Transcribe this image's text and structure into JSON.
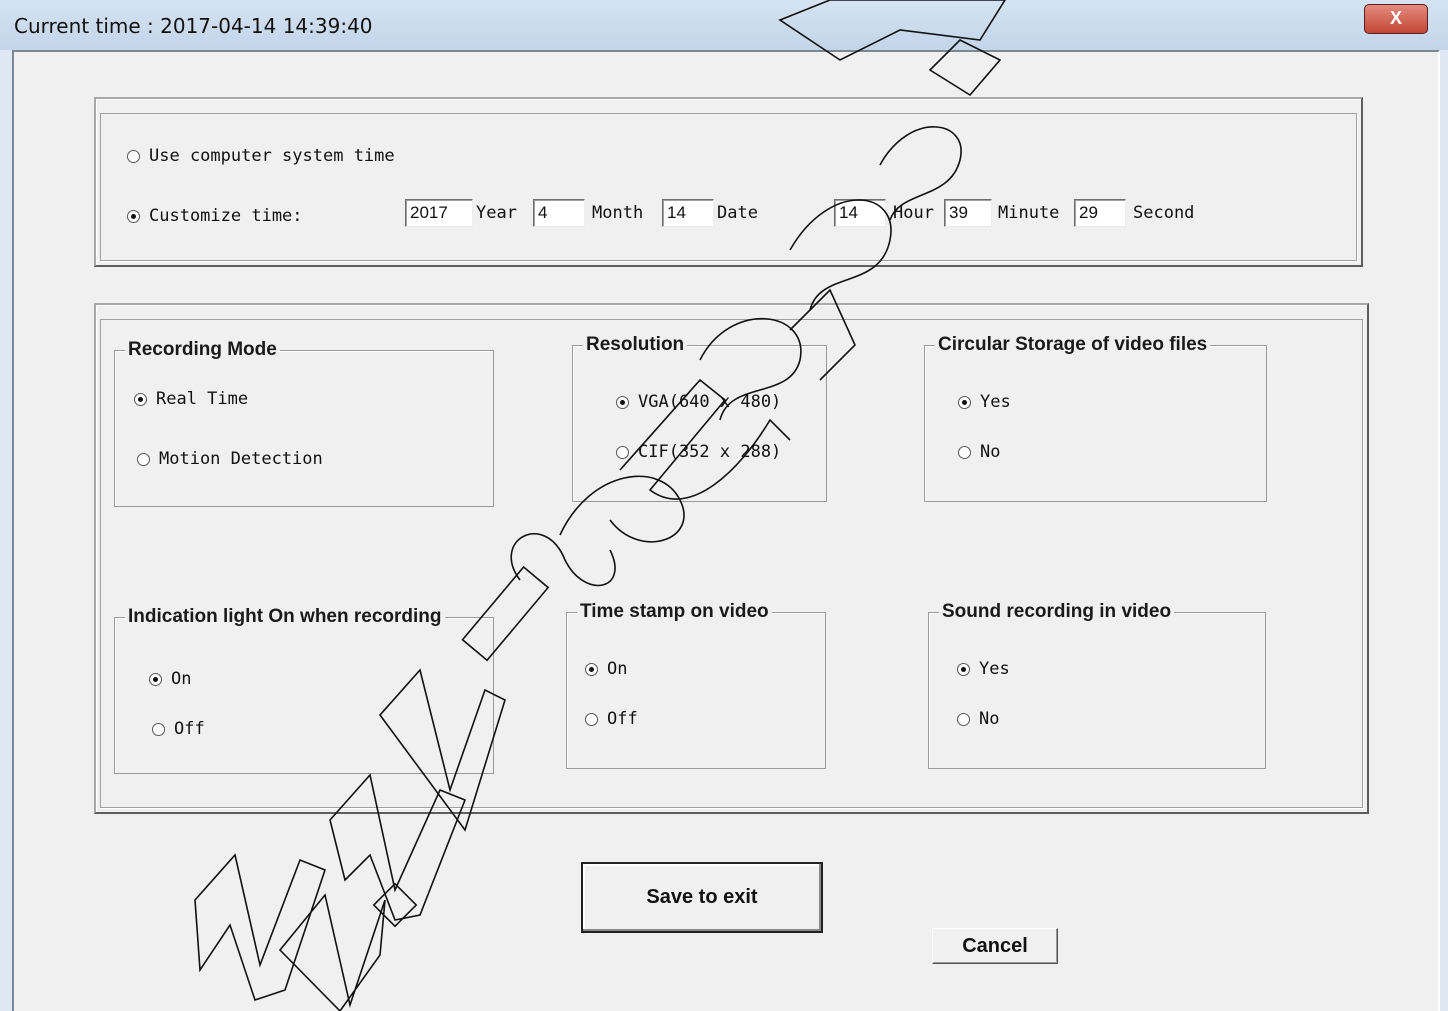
{
  "window": {
    "title": "Current time : 2017-04-14   14:39:40",
    "close_label": "X"
  },
  "time": {
    "system_label": "Use computer system time",
    "custom_label": "Customize time:",
    "fields": [
      {
        "value": "2017",
        "unit": "Year"
      },
      {
        "value": "4",
        "unit": "Month"
      },
      {
        "value": "14",
        "unit": "Date"
      },
      {
        "value": "14",
        "unit": "Hour"
      },
      {
        "value": "39",
        "unit": "Minute"
      },
      {
        "value": "29",
        "unit": "Second"
      }
    ]
  },
  "recording_mode": {
    "title": "Recording Mode",
    "options": [
      "Real Time",
      "Motion Detection"
    ],
    "selected": "Real Time"
  },
  "resolution": {
    "title": "Resolution",
    "options": [
      "VGA(640 x 480)",
      "CIF(352 x 288)"
    ],
    "selected": "VGA(640 x 480)"
  },
  "circular_storage": {
    "title": "Circular Storage of video files",
    "options": [
      "Yes",
      "No"
    ],
    "selected": "Yes"
  },
  "indication_light": {
    "title": "Indication light On when recording",
    "options": [
      "On",
      "Off"
    ],
    "selected": "On"
  },
  "time_stamp": {
    "title": "Time stamp on video",
    "options": [
      "On",
      "Off"
    ],
    "selected": "On"
  },
  "sound_recording": {
    "title": "Sound recording in video",
    "options": [
      "Yes",
      "No"
    ],
    "selected": "Yes"
  },
  "buttons": {
    "save": "Save to exit",
    "cancel": "Cancel"
  },
  "watermark": "www.wiseupsh"
}
